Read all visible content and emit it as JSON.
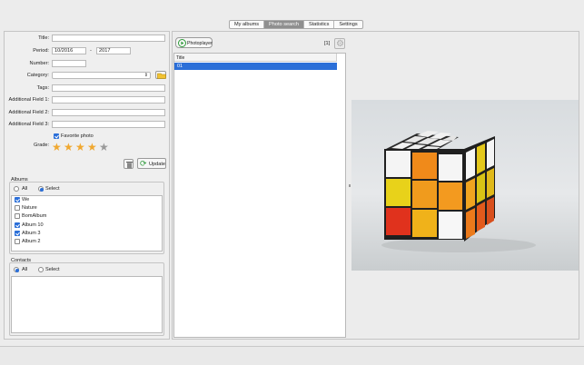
{
  "tabs": [
    {
      "label": "My albums",
      "active": false
    },
    {
      "label": "Photo search",
      "active": true
    },
    {
      "label": "Statistics",
      "active": false
    },
    {
      "label": "Settings",
      "active": false
    }
  ],
  "form": {
    "title_label": "Title:",
    "title_value": "",
    "period_label": "Period:",
    "period_from": "10/2016",
    "period_separator": "-",
    "period_to": "2017",
    "number_label": "Number:",
    "number_value": "",
    "category_label": "Category:",
    "category_value": "",
    "tags_label": "Tags:",
    "tags_value": "",
    "additional1_label": "Additional Field 1:",
    "additional2_label": "Additional Field 2:",
    "additional3_label": "Additional Field 3:",
    "favorite_label": "Favorite photo",
    "favorite_checked": true,
    "grade_label": "Grade:",
    "grade": 4,
    "grade_max": 5,
    "update_label": "Update"
  },
  "albums": {
    "title": "Albums",
    "all_label": "All",
    "select_label": "Select",
    "selected": "Select",
    "items": [
      {
        "label": "We",
        "checked": true
      },
      {
        "label": "Nature",
        "checked": false
      },
      {
        "label": "BomAlbum",
        "checked": false
      },
      {
        "label": "Album 10",
        "checked": true
      },
      {
        "label": "Album 3",
        "checked": true
      },
      {
        "label": "Album 2",
        "checked": false
      }
    ]
  },
  "contacts": {
    "title": "Contacts",
    "all_label": "All",
    "select_label": "Select",
    "selected": "All"
  },
  "results": {
    "photoplayer_label": "Photoplayer",
    "count_label": "[1]",
    "column_title": "Title",
    "rows": [
      "01"
    ]
  },
  "colors": {
    "accent": "#2b6fd8",
    "star_on": "#f0a830",
    "star_off": "#9a9a9a",
    "play": "#2e9a3a"
  }
}
